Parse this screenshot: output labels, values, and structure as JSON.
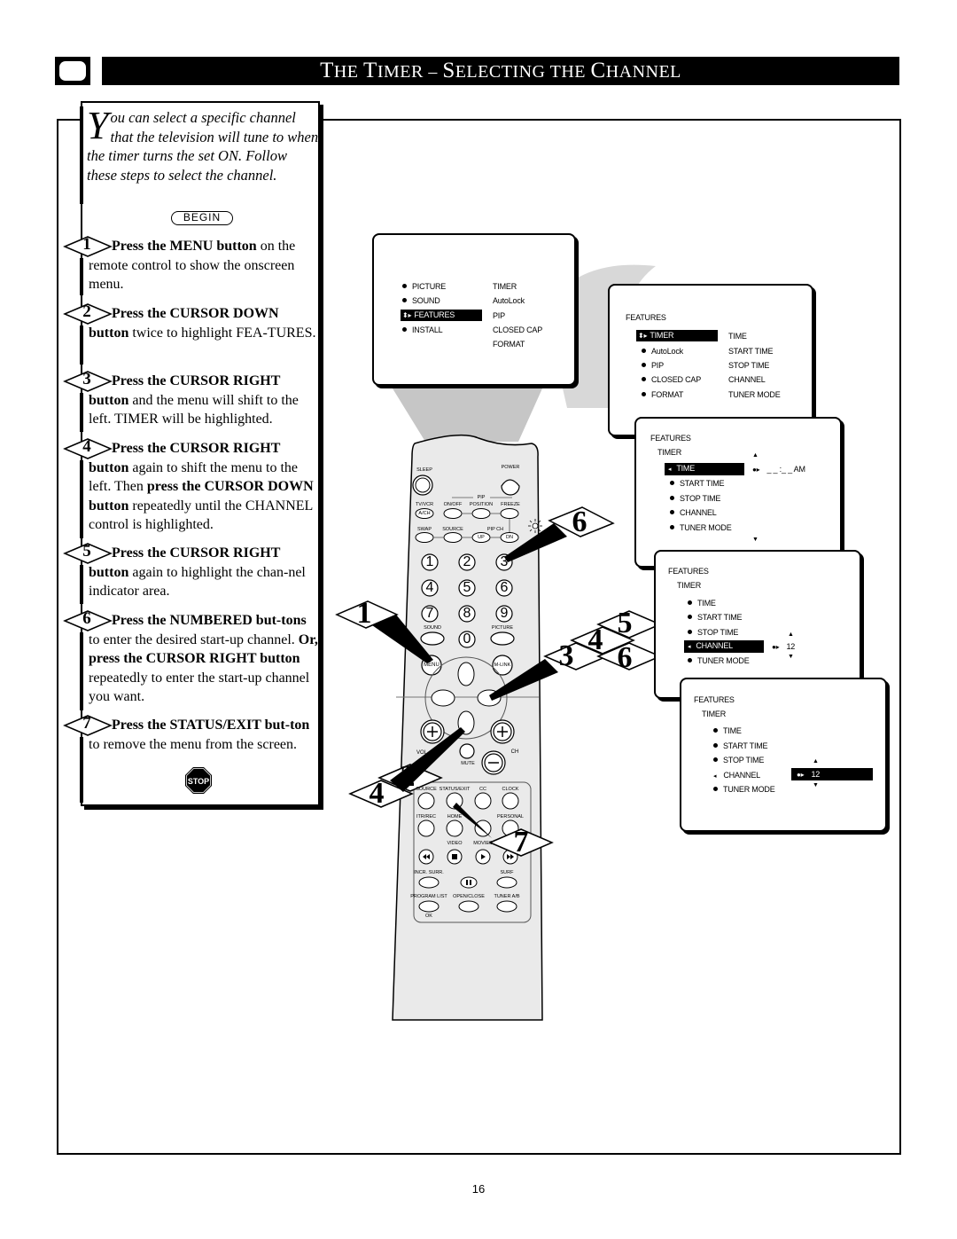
{
  "header": {
    "title_parts": [
      {
        "cap": "T",
        "rest": "HE "
      },
      {
        "cap": "T",
        "rest": "IMER – "
      },
      {
        "cap": "S",
        "rest": "ELECTING THE "
      },
      {
        "cap": "C",
        "rest": "HANNEL"
      }
    ]
  },
  "intro": {
    "drop_cap": "Y",
    "text": "ou can select a specific channel that the television will tune to when the timer turns the set ON. Follow these steps to select the channel."
  },
  "begin_label": "BEGIN",
  "steps": [
    {
      "num": "1",
      "bold": "Press the MENU button",
      "rest": " on the remote control to show the onscreen menu."
    },
    {
      "num": "2",
      "bold": "Press the CURSOR DOWN button",
      "rest": " twice to highlight FEA-TURES."
    },
    {
      "num": "3",
      "bold": "Press the CURSOR RIGHT button",
      "rest": " and the menu will shift to the left. TIMER will be highlighted."
    },
    {
      "num": "4",
      "bold": "Press the CURSOR RIGHT button",
      "rest": " again to shift the menu to the left. Then ",
      "bold2": "press the CURSOR DOWN button",
      "rest2": " repeatedly until the CHANNEL control is highlighted."
    },
    {
      "num": "5",
      "bold": "Press the CURSOR RIGHT button",
      "rest": " again to highlight the chan-nel indicator area."
    },
    {
      "num": "6",
      "bold": "Press the NUMBERED but-tons",
      "rest": " to enter the desired start-up channel.   ",
      "bold2": "Or, press the CURSOR RIGHT button",
      "rest2": " repeatedly to enter the start-up channel you want."
    },
    {
      "num": "7",
      "bold": "Press the STATUS/EXIT but-ton",
      "rest": " to remove the menu from the screen."
    }
  ],
  "stop_label": "STOP",
  "screens": {
    "main_menu": {
      "left": [
        "PICTURE",
        "SOUND",
        "FEATURES",
        "INSTALL"
      ],
      "highlighted": "FEATURES",
      "right": [
        "TIMER",
        "AutoLock",
        "PIP",
        "CLOSED CAP",
        "FORMAT"
      ]
    },
    "features_menu": {
      "header": "FEATURES",
      "left": [
        "TIMER",
        "AutoLock",
        "PIP",
        "CLOSED CAP",
        "FORMAT"
      ],
      "highlighted": "TIMER",
      "right": [
        "TIME",
        "START TIME",
        "STOP TIME",
        "CHANNEL",
        "TUNER MODE"
      ]
    },
    "timer_menu": {
      "header": "FEATURES",
      "sub": "TIMER",
      "items": [
        "TIME",
        "START TIME",
        "STOP TIME",
        "CHANNEL",
        "TUNER MODE"
      ],
      "highlighted": "TIME",
      "value": "_ _ :_ _  AM"
    },
    "timer_channel": {
      "header": "FEATURES",
      "sub": "TIMER",
      "items": [
        "TIME",
        "START TIME",
        "STOP TIME",
        "CHANNEL",
        "TUNER MODE"
      ],
      "highlighted": "CHANNEL",
      "value": "12"
    },
    "timer_channel_value": {
      "header": "FEATURES",
      "sub": "TIMER",
      "items": [
        "TIME",
        "START TIME",
        "STOP TIME",
        "CHANNEL",
        "TUNER MODE"
      ],
      "highlighted_value": "12"
    }
  },
  "remote": {
    "labels": {
      "sleep": "SLEEP",
      "power": "POWER",
      "pip": "PIP",
      "tvvcr": "TV/VCR",
      "onoff": "ON/OFF",
      "position": "POSITION",
      "freeze": "FREEZE",
      "ach": "A/CH",
      "swap": "SWAP",
      "source": "SOURCE",
      "pipch": "PIP CH",
      "up": "UP",
      "dn": "DN",
      "sound": "SOUND",
      "picture": "PICTURE",
      "menu": "MENU",
      "mlink": "M-LINK",
      "vol": "VOL",
      "ch": "CH",
      "mute": "MUTE",
      "source2": "SOURCE",
      "status": "STATUS/EXIT",
      "cc": "CC",
      "clock": "CLOCK",
      "itr": "ITR/REC",
      "home": "HOME",
      "personal": "PERSONAL",
      "video": "VIDEO",
      "movies": "MOVIES",
      "incr": "INCR. SURR.",
      "surf": "SURF",
      "proglist": "PROGRAM LIST",
      "openclose": "OPEN/CLOSE",
      "tunerab": "TUNER A/B",
      "ok": "OK"
    },
    "digits": [
      "1",
      "2",
      "3",
      "4",
      "5",
      "6",
      "7",
      "8",
      "9",
      "0"
    ]
  },
  "step_markers": [
    "1",
    "2",
    "3",
    "4",
    "5",
    "6",
    "6",
    "4",
    "7"
  ],
  "page_number": "16"
}
